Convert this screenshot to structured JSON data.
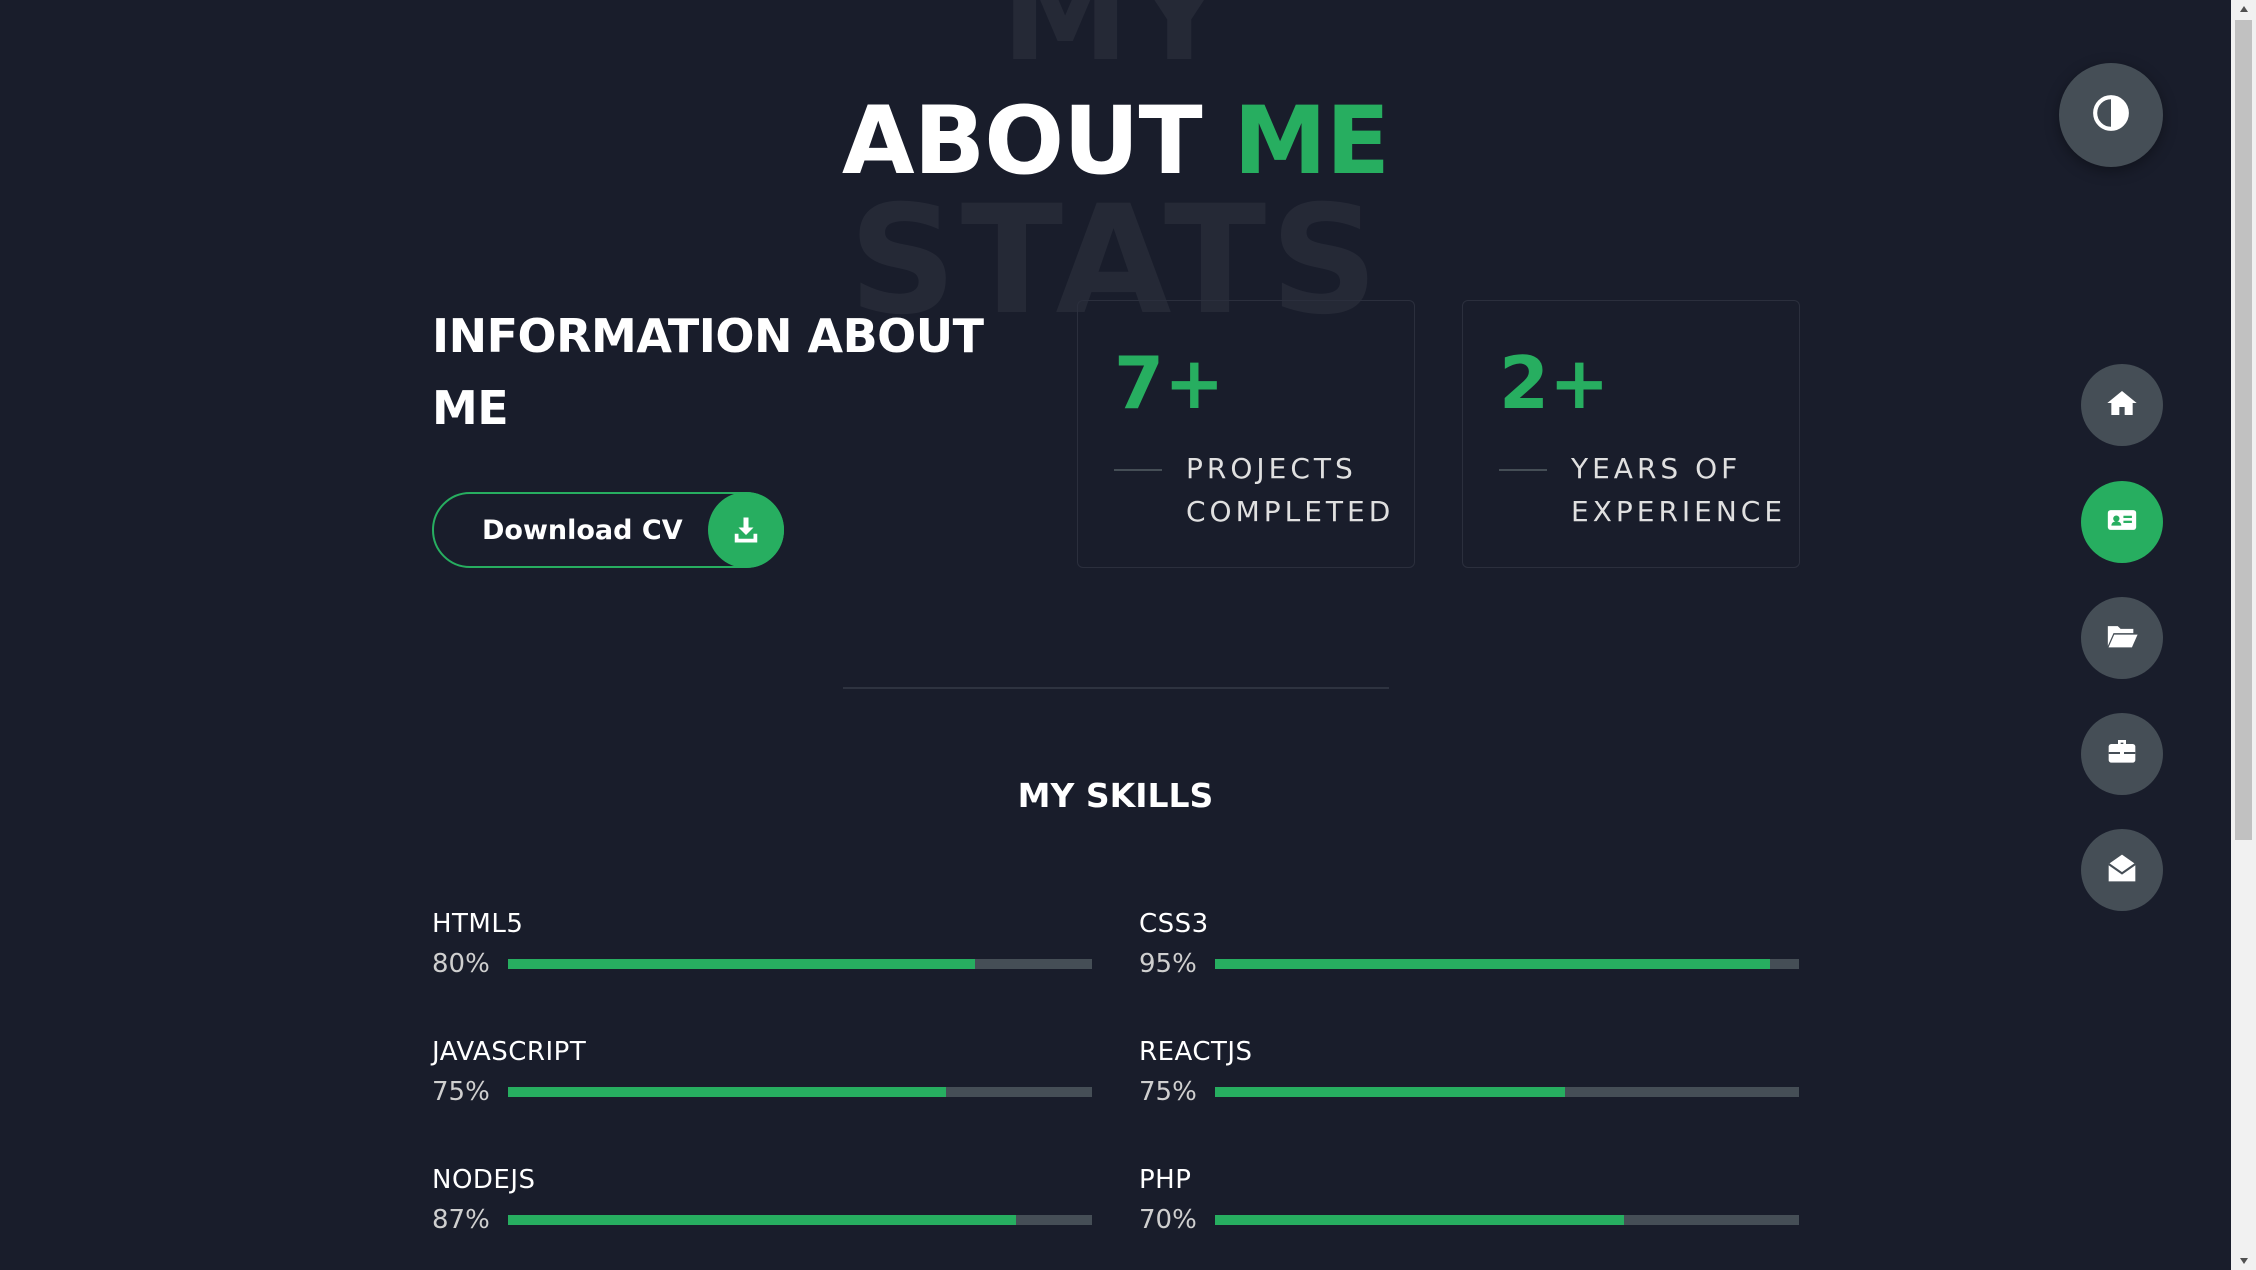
{
  "heading": {
    "bg_top": "MY",
    "bg_bottom": "STATS",
    "title": "ABOUT",
    "title_accent": "ME"
  },
  "info": {
    "title": "INFORMATION ABOUT ME",
    "cv_label": "Download CV"
  },
  "stats": [
    {
      "number": "7+",
      "label": "PROJECTS COMPLETED"
    },
    {
      "number": "2+",
      "label": "YEARS OF EXPERIENCE"
    }
  ],
  "skills": {
    "title": "MY SKILLS",
    "items": [
      {
        "name": "HTML5",
        "percent_label": "80%",
        "fill": 0.8
      },
      {
        "name": "CSS3",
        "percent_label": "95%",
        "fill": 0.95
      },
      {
        "name": "JAVASCRIPT",
        "percent_label": "75%",
        "fill": 0.75
      },
      {
        "name": "REACTJS",
        "percent_label": "75%",
        "fill": 0.6
      },
      {
        "name": "NODEJS",
        "percent_label": "87%",
        "fill": 0.87
      },
      {
        "name": "PHP",
        "percent_label": "70%",
        "fill": 0.7
      }
    ]
  },
  "controls": {
    "theme_icon": "contrast-icon",
    "nav": [
      {
        "icon": "home-icon",
        "active": false
      },
      {
        "icon": "id-card-icon",
        "active": true
      },
      {
        "icon": "folder-open-icon",
        "active": false
      },
      {
        "icon": "briefcase-icon",
        "active": false
      },
      {
        "icon": "envelope-open-icon",
        "active": false
      }
    ]
  },
  "colors": {
    "background": "#191d2b",
    "accent": "#27ae60",
    "grey": "#454e56"
  }
}
